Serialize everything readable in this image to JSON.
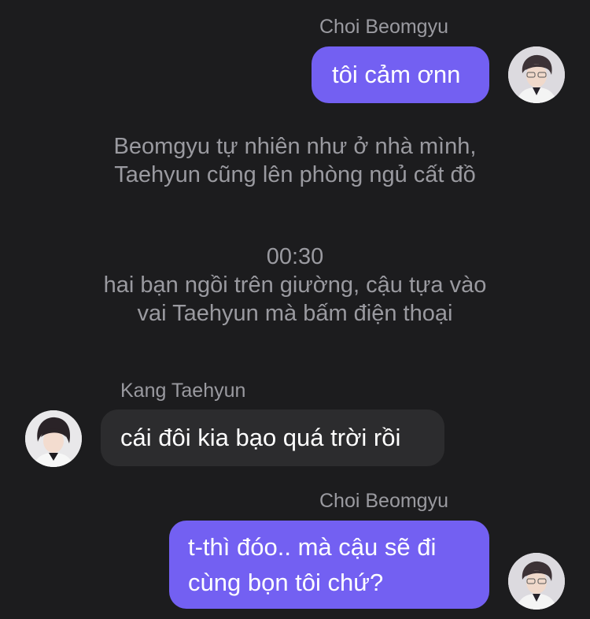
{
  "colors": {
    "background": "#1c1c1e",
    "outgoing_bubble": "#7360f2",
    "incoming_bubble": "#2c2c2e",
    "muted_text": "#9a9aa0",
    "message_text": "#ffffff"
  },
  "messages": [
    {
      "sender": "Choi Beomgyu",
      "direction": "outgoing",
      "avatar_icon": "avatar-beomgyu",
      "text": "tôi cảm ơnn"
    },
    {
      "type": "narration",
      "lines": [
        "Beomgyu tự nhiên như ở nhà mình,",
        "Taehyun cũng lên phòng ngủ cất đồ"
      ]
    },
    {
      "type": "narration",
      "lines": [
        "00:30",
        "hai bạn ngồi trên giường, cậu tựa vào",
        "vai Taehyun mà bấm điện thoại"
      ]
    },
    {
      "sender": "Kang Taehyun",
      "direction": "incoming",
      "avatar_icon": "avatar-taehyun",
      "text": "cái đôi kia bạo quá trời rồi"
    },
    {
      "sender": "Choi Beomgyu",
      "direction": "outgoing",
      "avatar_icon": "avatar-beomgyu",
      "lines": [
        "t-thì đóo.. mà cậu sẽ đi",
        "cùng bọn tôi chứ?"
      ]
    }
  ]
}
